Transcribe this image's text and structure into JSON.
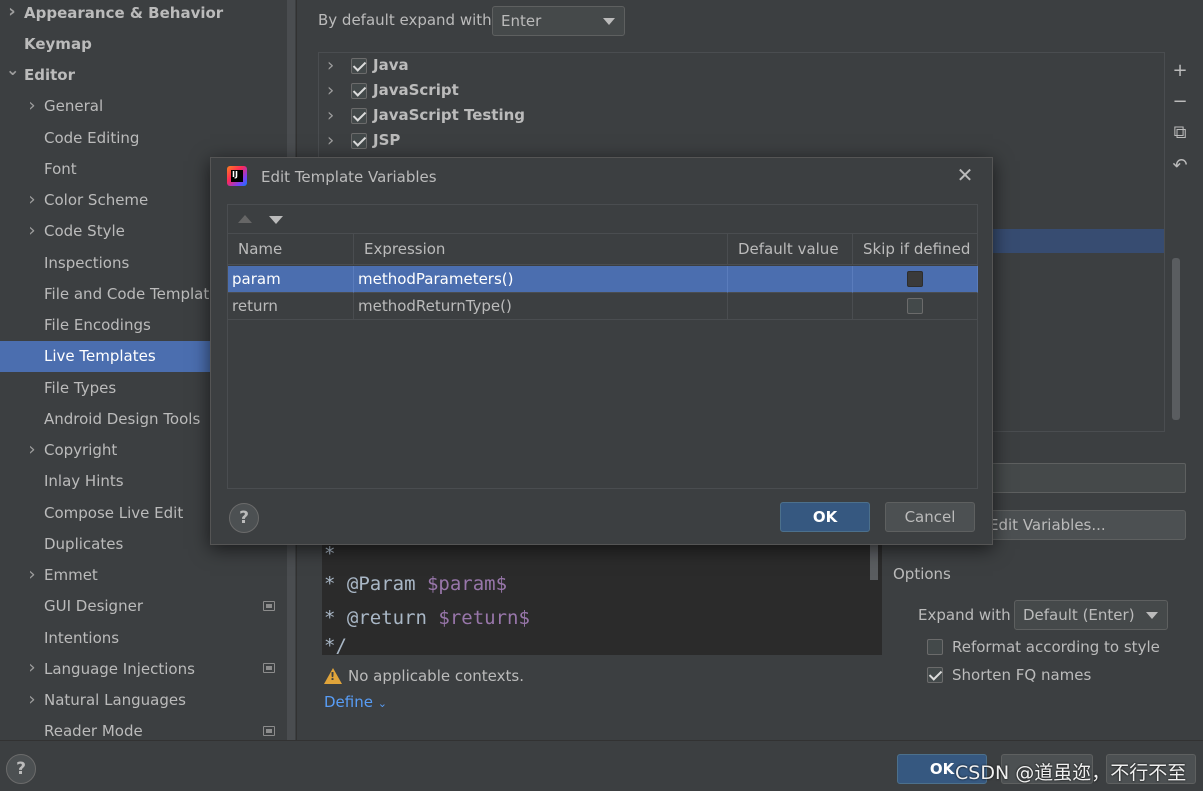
{
  "sidebar": {
    "items": [
      {
        "label": "Appearance & Behavior",
        "chevron": "right",
        "bold": true
      },
      {
        "label": "Keymap",
        "chevron": "",
        "bold": true
      },
      {
        "label": "Editor",
        "chevron": "down",
        "bold": true
      },
      {
        "label": "General",
        "chevron": "right"
      },
      {
        "label": "Code Editing",
        "chevron": ""
      },
      {
        "label": "Font",
        "chevron": ""
      },
      {
        "label": "Color Scheme",
        "chevron": "right"
      },
      {
        "label": "Code Style",
        "chevron": "right"
      },
      {
        "label": "Inspections",
        "chevron": ""
      },
      {
        "label": "File and Code Templates",
        "chevron": ""
      },
      {
        "label": "File Encodings",
        "chevron": ""
      },
      {
        "label": "Live Templates",
        "chevron": "",
        "selected": true
      },
      {
        "label": "File Types",
        "chevron": ""
      },
      {
        "label": "Android Design Tools",
        "chevron": ""
      },
      {
        "label": "Copyright",
        "chevron": "right"
      },
      {
        "label": "Inlay Hints",
        "chevron": ""
      },
      {
        "label": "Compose Live Edit",
        "chevron": ""
      },
      {
        "label": "Duplicates",
        "chevron": ""
      },
      {
        "label": "Emmet",
        "chevron": "right"
      },
      {
        "label": "GUI Designer",
        "chevron": "",
        "project_icon": true
      },
      {
        "label": "Intentions",
        "chevron": ""
      },
      {
        "label": "Language Injections",
        "chevron": "right",
        "project_icon": true
      },
      {
        "label": "Natural Languages",
        "chevron": "right"
      },
      {
        "label": "Reader Mode",
        "chevron": "",
        "project_icon": true
      }
    ]
  },
  "main": {
    "expand_label": "By default expand with",
    "expand_value": "Enter",
    "tree": [
      {
        "label": "Java",
        "checked": true
      },
      {
        "label": "JavaScript",
        "checked": true
      },
      {
        "label": "JavaScript Testing",
        "checked": true
      },
      {
        "label": "JSP",
        "checked": true
      }
    ],
    "edit_variables_label": "Edit Variables...",
    "editor_lines": [
      {
        "prefix": "*",
        "var": ""
      },
      {
        "prefix": "* @Param ",
        "var": "$param$"
      },
      {
        "prefix": "* @return ",
        "var": "$return$"
      },
      {
        "prefix": "*/",
        "var": ""
      }
    ],
    "warning_text": "No applicable contexts.",
    "define_label": "Define",
    "options_label": "Options",
    "expand_with_label": "Expand with",
    "expand_with_value": "Default (Enter)",
    "reformat_label": "Reformat according to style",
    "reformat_checked": false,
    "shorten_label": "Shorten FQ names",
    "shorten_checked": true
  },
  "dialog": {
    "title": "Edit Template Variables",
    "columns": [
      "Name",
      "Expression",
      "Default value",
      "Skip if defined"
    ],
    "rows": [
      {
        "name": "param",
        "expression": "methodParameters()",
        "default": "",
        "skip": false,
        "selected": true
      },
      {
        "name": "return",
        "expression": "methodReturnType()",
        "default": "",
        "skip": false,
        "selected": false
      }
    ],
    "ok_label": "OK",
    "cancel_label": "Cancel"
  },
  "bottom": {
    "ok_label": "OK",
    "watermark": "CSDN @道虽迩，不行不至"
  },
  "colors": {
    "selection": "#4b6eaf",
    "background": "#3c3f41",
    "editor_bg": "#2b2b2b",
    "template_var": "#9876aa",
    "warning": "#e0a43a",
    "link": "#589df6"
  }
}
